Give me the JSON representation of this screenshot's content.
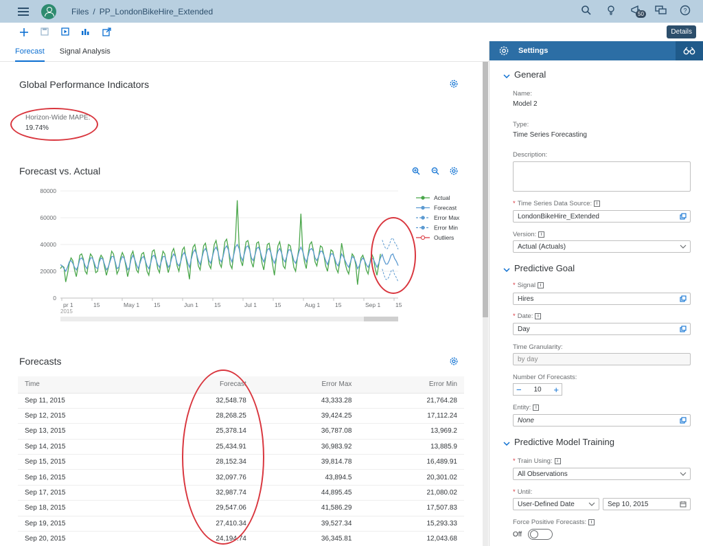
{
  "shell": {
    "breadcrumb": [
      "Files",
      "/",
      "PP_LondonBikeHire_Extended"
    ],
    "notifications_count": "50"
  },
  "toolbar": {
    "details_label": "Details"
  },
  "tabs": [
    {
      "label": "Forecast",
      "active": true
    },
    {
      "label": "Signal Analysis",
      "active": false
    }
  ],
  "gpi": {
    "title": "Global Performance Indicators",
    "mape_label": "Horizon-Wide MAPE:",
    "mape_value": "19.74%"
  },
  "forecast_chart_title": "Forecast vs. Actual",
  "chart_data": {
    "type": "line",
    "title": "",
    "ylim": [
      0,
      80000
    ],
    "yticks": [
      "80000",
      "60000",
      "40000",
      "20000",
      "0"
    ],
    "xticks": [
      "pr 1",
      "15",
      "May 1",
      "15",
      "Jun 1",
      "15",
      "Jul 1",
      "15",
      "Aug 1",
      "15",
      "Sep 1",
      "15"
    ],
    "year_label": "2015",
    "legend": [
      "Actual",
      "Forecast",
      "Error Max",
      "Error Min",
      "Outliers"
    ],
    "colors": {
      "Actual": "#4aa64a",
      "Forecast": "#5c9ad1",
      "Error Max": "#5c9ad1",
      "Error Min": "#5c9ad1",
      "Outliers": "#d9363e"
    },
    "series": [
      {
        "name": "Actual",
        "x_start_day": 0,
        "values": [
          22000,
          24000,
          23000,
          12000,
          18000,
          26000,
          30000,
          28000,
          21000,
          16000,
          24000,
          32000,
          33000,
          29000,
          20000,
          18000,
          27000,
          33000,
          31000,
          26000,
          19000,
          20000,
          29000,
          32000,
          30000,
          23000,
          17000,
          22000,
          28000,
          35000,
          33000,
          26000,
          18000,
          21000,
          30000,
          34000,
          31000,
          24000,
          16000,
          22000,
          32000,
          35000,
          29000,
          21000,
          19000,
          27000,
          33000,
          34000,
          28000,
          20000,
          17000,
          26000,
          35000,
          36000,
          30000,
          22000,
          19000,
          28000,
          35000,
          33000,
          25000,
          19000,
          24000,
          34000,
          37000,
          32000,
          24000,
          20000,
          27000,
          36000,
          38000,
          30000,
          22000,
          14000,
          30000,
          38000,
          40000,
          33000,
          24000,
          21000,
          30000,
          39000,
          41000,
          34000,
          25000,
          22000,
          31000,
          40000,
          43000,
          36000,
          26000,
          23000,
          32000,
          42000,
          44000,
          37000,
          25000,
          22000,
          33000,
          44000,
          73000,
          40000,
          28000,
          24000,
          34000,
          42000,
          43000,
          37000,
          27000,
          23000,
          32000,
          41000,
          42000,
          35000,
          26000,
          21000,
          30000,
          40000,
          41000,
          34000,
          25000,
          17000,
          29000,
          39000,
          42000,
          35000,
          24000,
          22000,
          31000,
          40000,
          39000,
          32000,
          23000,
          20000,
          30000,
          38000,
          63000,
          36000,
          27000,
          22000,
          32000,
          40000,
          42000,
          36000,
          27000,
          24000,
          31000,
          39000,
          38000,
          32000,
          24000,
          20000,
          28000,
          36000,
          35000,
          29000,
          22000,
          19000,
          27000,
          41000,
          34000,
          26000,
          21000,
          18000,
          26000,
          33000,
          31000,
          25000,
          10000,
          22000,
          30000,
          32000,
          28000,
          21000,
          18000,
          26000,
          33000,
          30000,
          22000,
          17000,
          25000,
          33000
        ]
      },
      {
        "name": "Forecast",
        "values": [
          25000,
          24000,
          22000,
          20000,
          23000,
          27000,
          28000,
          26000,
          23000,
          21000,
          24000,
          29000,
          30000,
          28000,
          24000,
          22000,
          26000,
          30000,
          30000,
          27000,
          23000,
          22000,
          27000,
          30000,
          29000,
          25000,
          21000,
          23000,
          27000,
          31000,
          31000,
          27000,
          22000,
          23000,
          28000,
          31000,
          30000,
          26000,
          21000,
          23000,
          29000,
          32000,
          29000,
          25000,
          22000,
          26000,
          30000,
          31000,
          28000,
          24000,
          22000,
          26000,
          31000,
          32000,
          29000,
          25000,
          23000,
          27000,
          31000,
          31000,
          27000,
          23000,
          25000,
          30000,
          33000,
          31000,
          26000,
          24000,
          27000,
          32000,
          34000,
          31000,
          26000,
          23000,
          29000,
          34000,
          36000,
          33000,
          28000,
          25000,
          30000,
          35000,
          37000,
          34000,
          28000,
          26000,
          31000,
          36000,
          38000,
          35000,
          29000,
          27000,
          31000,
          37000,
          39000,
          36000,
          30000,
          27000,
          32000,
          38000,
          40000,
          37000,
          31000,
          28000,
          33000,
          38000,
          39000,
          36000,
          30000,
          28000,
          32000,
          37000,
          38000,
          35000,
          30000,
          27000,
          31000,
          36000,
          37000,
          34000,
          29000,
          26000,
          30000,
          35000,
          37000,
          34000,
          29000,
          27000,
          31000,
          36000,
          36000,
          33000,
          28000,
          26000,
          30000,
          35000,
          38000,
          35000,
          30000,
          27000,
          31000,
          36000,
          37000,
          35000,
          30000,
          28000,
          31000,
          35000,
          35000,
          32000,
          28000,
          25000,
          29000,
          33000,
          33000,
          30000,
          26000,
          24000,
          28000,
          33000,
          31000,
          28000,
          25000,
          23000,
          27000,
          31000,
          30000,
          27000,
          22000,
          24000,
          28000,
          30000,
          28000,
          25000,
          23000,
          26000,
          30000,
          29000,
          26000,
          23000,
          26000,
          30000
        ]
      }
    ],
    "horizon": {
      "forecast": [
        32548.78,
        28268.25,
        25378.14,
        25434.91,
        28152.34,
        32097.76,
        32987.74,
        29547.06,
        27410.34,
        24194.74
      ],
      "error_max": [
        43333.28,
        39424.25,
        36787.08,
        36983.92,
        39814.78,
        43894.5,
        44895.45,
        41586.29,
        39527.34,
        36345.81
      ],
      "error_min": [
        21764.28,
        17112.24,
        13969.2,
        13885.9,
        16489.91,
        20301.02,
        21080.02,
        17507.83,
        15293.33,
        12043.68
      ]
    }
  },
  "forecasts": {
    "title": "Forecasts",
    "columns": [
      "Time",
      "Forecast",
      "Error Max",
      "Error Min"
    ],
    "rows": [
      [
        "Sep 11, 2015",
        "32,548.78",
        "43,333.28",
        "21,764.28"
      ],
      [
        "Sep 12, 2015",
        "28,268.25",
        "39,424.25",
        "17,112.24"
      ],
      [
        "Sep 13, 2015",
        "25,378.14",
        "36,787.08",
        "13,969.2"
      ],
      [
        "Sep 14, 2015",
        "25,434.91",
        "36,983.92",
        "13,885.9"
      ],
      [
        "Sep 15, 2015",
        "28,152.34",
        "39,814.78",
        "16,489.91"
      ],
      [
        "Sep 16, 2015",
        "32,097.76",
        "43,894.5",
        "20,301.02"
      ],
      [
        "Sep 17, 2015",
        "32,987.74",
        "44,895.45",
        "21,080.02"
      ],
      [
        "Sep 18, 2015",
        "29,547.06",
        "41,586.29",
        "17,507.83"
      ],
      [
        "Sep 19, 2015",
        "27,410.34",
        "39,527.34",
        "15,293.33"
      ],
      [
        "Sep 20, 2015",
        "24,194.74",
        "36,345.81",
        "12,043.68"
      ]
    ]
  },
  "settings": {
    "title": "Settings",
    "general": {
      "title": "General",
      "name_label": "Name:",
      "name_value": "Model 2",
      "type_label": "Type:",
      "type_value": "Time Series Forecasting",
      "description_label": "Description:",
      "source_label": "Time Series Data Source:",
      "source_value": "LondonBikeHire_Extended",
      "version_label": "Version:",
      "version_value": "Actual (Actuals)"
    },
    "goal": {
      "title": "Predictive Goal",
      "signal_label": "Signal",
      "signal_value": "Hires",
      "date_label": "Date:",
      "date_value": "Day",
      "granularity_label": "Time Granularity:",
      "granularity_value": "by day",
      "nforecasts_label": "Number Of Forecasts:",
      "nforecasts_value": "10",
      "entity_label": "Entity:",
      "entity_value": "None"
    },
    "training": {
      "title": "Predictive Model Training",
      "train_using_label": "Train Using:",
      "train_using_value": "All Observations",
      "until_label": "Until:",
      "until_mode": "User-Defined Date",
      "until_date": "Sep 10, 2015",
      "force_label": "Force Positive Forecasts:",
      "force_value": "Off"
    }
  }
}
